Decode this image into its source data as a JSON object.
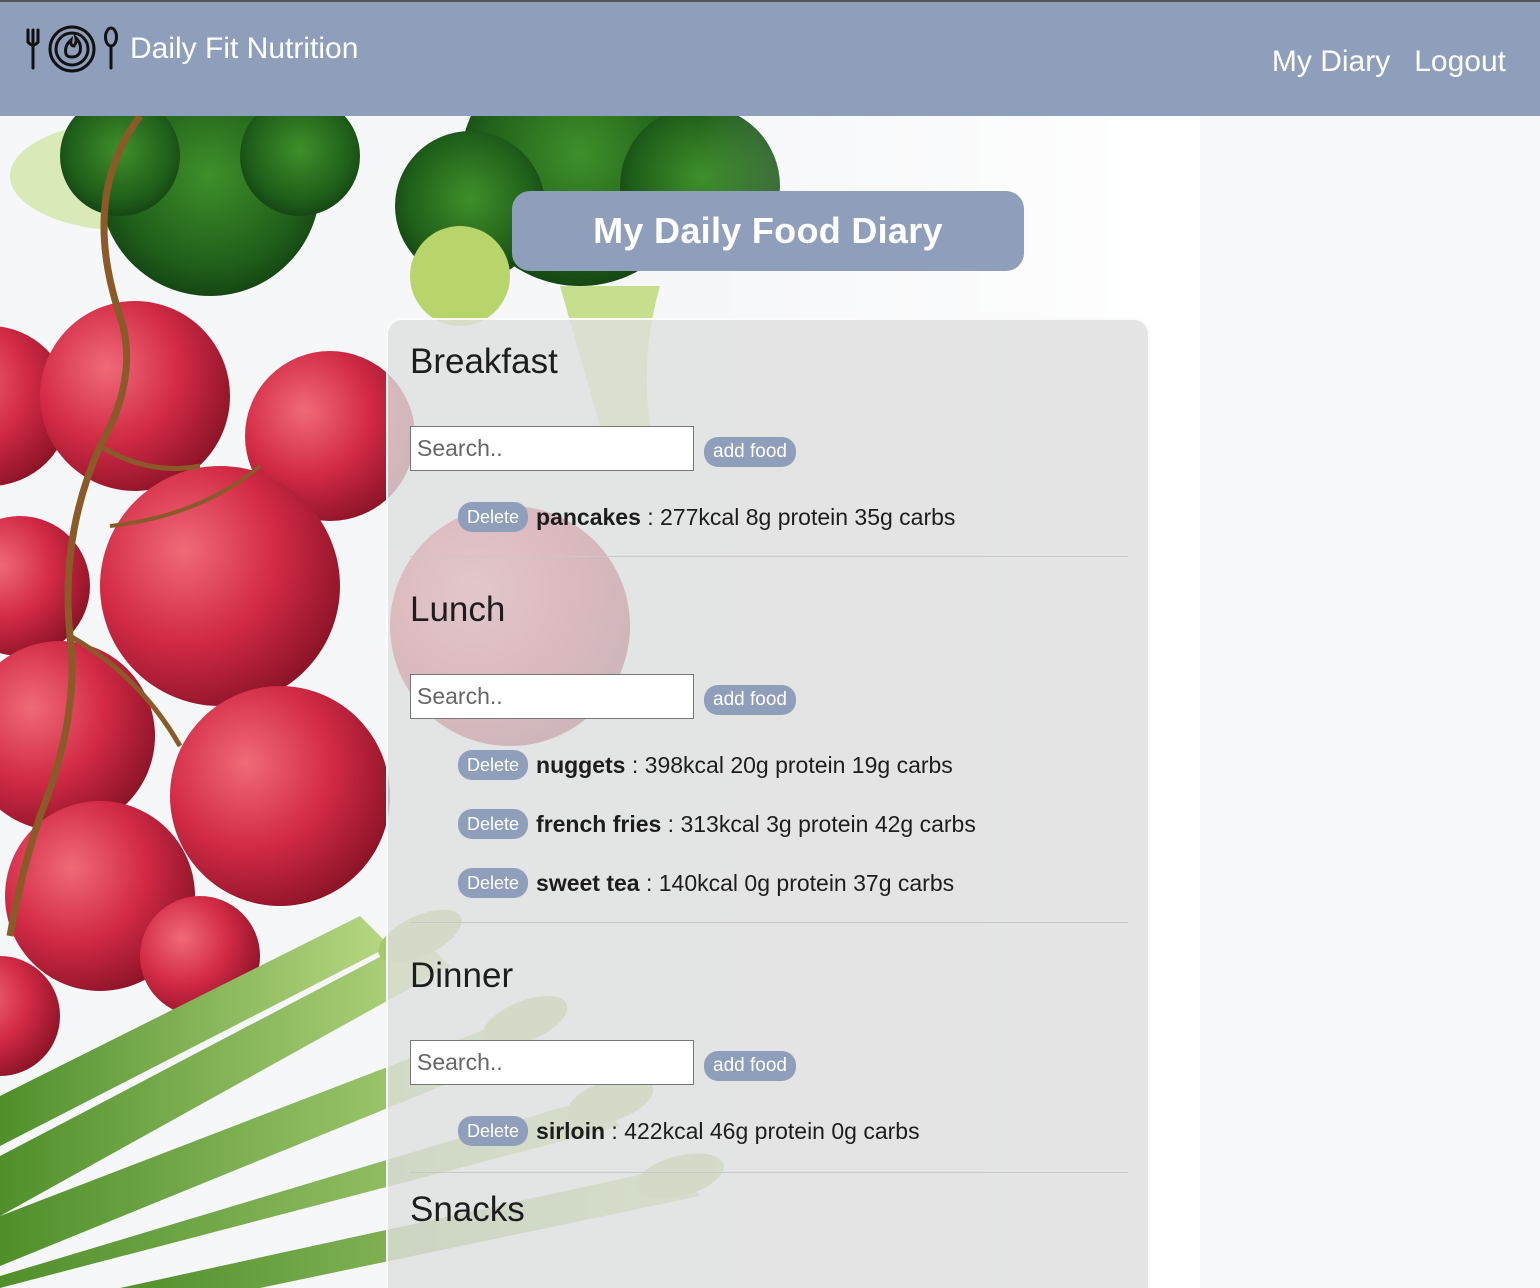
{
  "header": {
    "brand": "Daily Fit Nutrition",
    "nav": [
      "My Diary",
      "Logout"
    ]
  },
  "page_title": "My Daily Food Diary",
  "colors": {
    "accent": "#8f9fbb",
    "header_text": "#ffffff"
  },
  "meals": [
    {
      "title": "Breakfast",
      "search_placeholder": "Search..",
      "add_label": "add food",
      "entries": [
        {
          "delete_label": "Delete",
          "name": "pancakes",
          "details": " : 277kcal 8g protein 35g carbs"
        }
      ]
    },
    {
      "title": "Lunch",
      "search_placeholder": "Search..",
      "add_label": "add food",
      "entries": [
        {
          "delete_label": "Delete",
          "name": "nuggets",
          "details": " : 398kcal 20g protein 19g carbs"
        },
        {
          "delete_label": "Delete",
          "name": "french fries",
          "details": " : 313kcal 3g protein 42g carbs"
        },
        {
          "delete_label": "Delete",
          "name": "sweet tea",
          "details": " : 140kcal 0g protein 37g carbs"
        }
      ]
    },
    {
      "title": "Dinner",
      "search_placeholder": "Search..",
      "add_label": "add food",
      "entries": [
        {
          "delete_label": "Delete",
          "name": "sirloin",
          "details": " : 422kcal 46g protein 0g carbs"
        }
      ]
    },
    {
      "title": "Snacks"
    }
  ]
}
